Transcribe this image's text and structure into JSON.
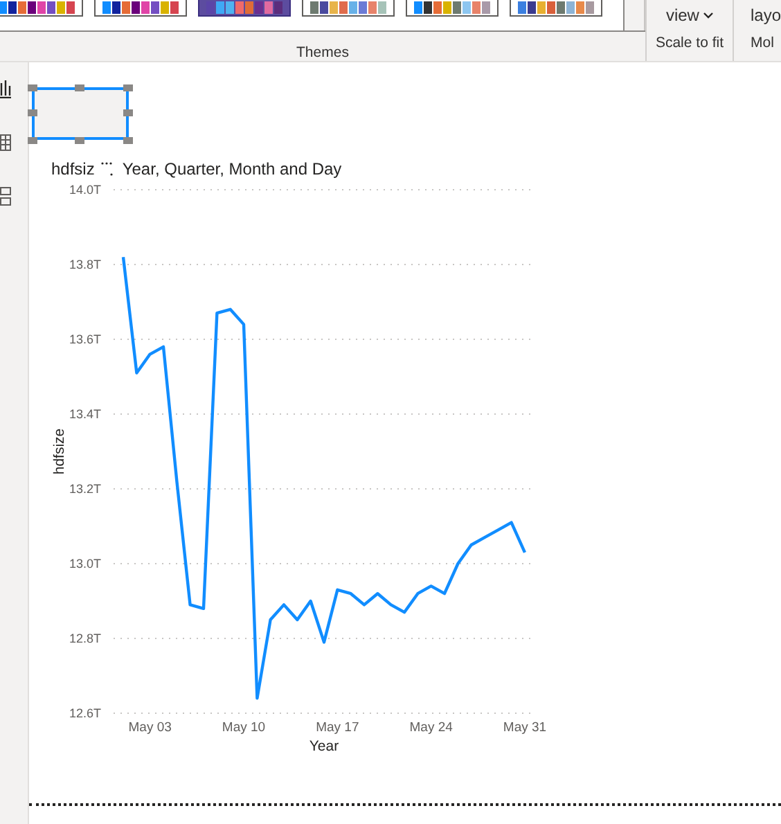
{
  "ribbon": {
    "themes": [
      {
        "selected": false
      },
      {
        "selected": false
      },
      {
        "selected": true
      },
      {
        "selected": false
      },
      {
        "selected": false
      },
      {
        "selected": false
      }
    ],
    "themes_label": "Themes",
    "page_view_button": {
      "label": "view"
    },
    "scale_label": "Scale to fit",
    "mobile_button": {
      "label": "layo"
    },
    "mobile_label": "Mol"
  },
  "left_pane": {
    "views": [
      {
        "kind": "report",
        "selected": true
      },
      {
        "kind": "data",
        "selected": false
      },
      {
        "kind": "model",
        "selected": false
      }
    ]
  },
  "canvas": {
    "placeholder_visual": {
      "selected": true
    },
    "chart": {
      "title": "hdfsiz",
      "subtitle": "Year, Quarter, Month and Day",
      "chart_data": {
        "type": "line",
        "grid": true,
        "xlabel": "Year",
        "ylabel": "hdfsize",
        "categories": [
          null,
          null,
          "May 03",
          null,
          null,
          null,
          null,
          null,
          null,
          "May 10",
          null,
          null,
          null,
          null,
          null,
          null,
          "May 17",
          null,
          null,
          null,
          null,
          null,
          null,
          "May 24",
          null,
          null,
          null,
          null,
          null,
          null,
          "May 31"
        ],
        "series": [
          {
            "color": "#118dff",
            "values": [
              13.82,
              13.51,
              13.56,
              13.58,
              13.22,
              12.89,
              12.88,
              13.67,
              13.68,
              13.64,
              12.64,
              12.85,
              12.89,
              12.85,
              12.9,
              12.79,
              12.93,
              12.92,
              12.89,
              12.92,
              12.89,
              12.87,
              12.92,
              12.94,
              12.92,
              13.0,
              13.05,
              13.07,
              13.09,
              13.11,
              13.03
            ]
          }
        ],
        "ylim": [
          12.6,
          14.0
        ],
        "yticks": [
          {
            "value": 12.6,
            "label": "12.6T"
          },
          {
            "value": 12.8,
            "label": "12.8T"
          },
          {
            "value": 13.0,
            "label": "13.0T"
          },
          {
            "value": 13.2,
            "label": "13.2T"
          },
          {
            "value": 13.4,
            "label": "13.4T"
          },
          {
            "value": 13.6,
            "label": "13.6T"
          },
          {
            "value": 13.8,
            "label": "13.8T"
          },
          {
            "value": 14.0,
            "label": "14.0T"
          }
        ]
      }
    }
  }
}
